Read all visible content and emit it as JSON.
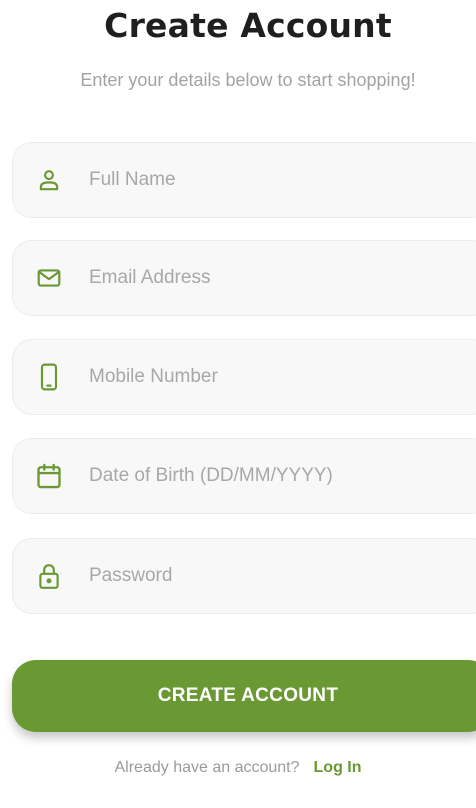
{
  "header": {
    "title": "Create Account",
    "subtitle": "Enter your details below to start shopping!"
  },
  "form": {
    "fields": [
      {
        "name": "full_name",
        "placeholder": "Full Name",
        "value": "",
        "icon": "person-icon"
      },
      {
        "name": "email",
        "placeholder": "Email Address",
        "value": "",
        "icon": "mail-icon"
      },
      {
        "name": "mobile",
        "placeholder": "Mobile Number",
        "value": "",
        "icon": "phone-icon"
      },
      {
        "name": "dob",
        "placeholder": "Date of Birth (DD/MM/YYYY)",
        "value": "",
        "icon": "calendar-icon"
      },
      {
        "name": "password",
        "placeholder": "Password",
        "value": "",
        "icon": "lock-icon"
      }
    ],
    "submit_label": "CREATE ACCOUNT"
  },
  "footer": {
    "prompt": "Already have an account?",
    "login_label": "Log In"
  },
  "colors": {
    "accent": "#6a9934",
    "field_bg": "#f7f8f7",
    "placeholder": "#a8a8a8",
    "title": "#1f1f1f"
  }
}
